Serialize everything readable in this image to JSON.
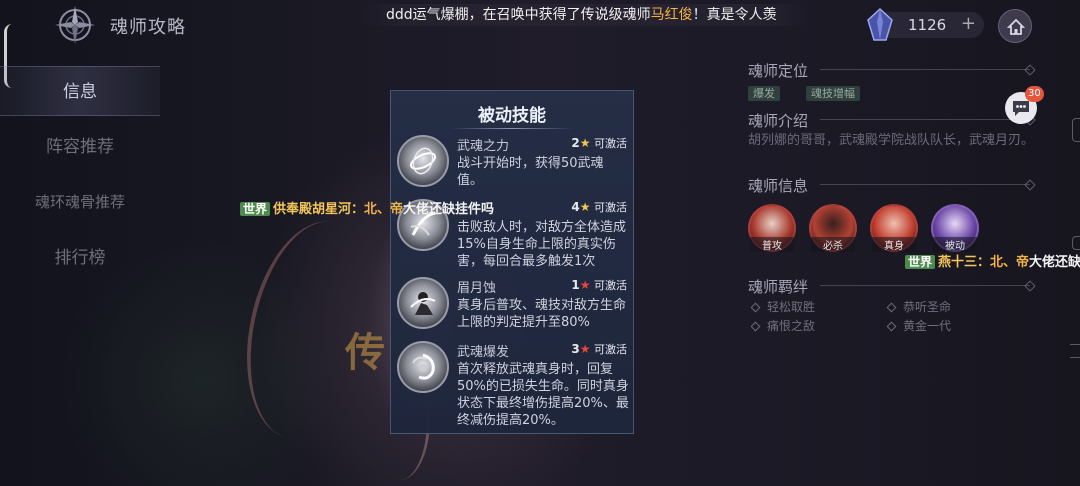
{
  "header": {
    "title": "魂师攻略",
    "marquee": {
      "prefix": "ddd运气爆棚，在召唤中获得了传说级魂师",
      "highlight": "马红俊",
      "suffix": "！真是令人羡"
    },
    "currency": {
      "value": "1126",
      "plus": "+"
    }
  },
  "nav": {
    "items": [
      {
        "label": "信息",
        "active": true
      },
      {
        "label": "阵容推荐"
      },
      {
        "label": "魂环魂骨推荐"
      },
      {
        "label": "排行榜"
      }
    ]
  },
  "world_chat": [
    {
      "tag": "世界",
      "name": "供奉殿胡星河：",
      "highlight": "北、帝",
      "text": "大佬还缺挂件吗"
    },
    {
      "tag": "世界",
      "name": "燕十三：",
      "highlight": "北、帝",
      "text": "大佬还缺"
    }
  ],
  "popup": {
    "title": "被动技能",
    "skills": [
      {
        "name": "武魂之力",
        "level": "2",
        "star": "★",
        "status": "可激活",
        "desc": "战斗开始时，获得50武魂值。"
      },
      {
        "name": "",
        "level": "4",
        "star": "★",
        "status": "可激活",
        "desc": "击败敌人时，对敌方全体造成15%自身生命上限的真实伤害，每回合最多触发1次"
      },
      {
        "name": "眉月蚀",
        "level": "1",
        "star": "★",
        "status": "可激活",
        "desc": "真身后普攻、魂技对敌方生命上限的判定提升至80%"
      },
      {
        "name": "武魂爆发",
        "level": "3",
        "star": "★",
        "status": "可激活",
        "desc": "首次释放武魂真身时，回复50%的已损失生命。同时真身状态下最终增伤提高20%、最终减伤提高20%。"
      }
    ]
  },
  "right_panel": {
    "position": {
      "heading": "魂师定位",
      "tags": [
        "爆发",
        "魂技增幅"
      ]
    },
    "intro": {
      "heading": "魂师介绍",
      "text": "胡列娜的哥哥，武魂殿学院战队队长，武魂月刃。"
    },
    "info": {
      "heading": "魂师信息",
      "skills": [
        "普攻",
        "必杀",
        "真身",
        "被动"
      ]
    },
    "bonds": {
      "heading": "魂师羁绊",
      "items": [
        "轻松取胜",
        "恭听圣命",
        "痛恨之敌",
        "黄金一代"
      ]
    }
  },
  "chat_button": {
    "badge": "30"
  },
  "colors": {
    "accent": "#f3b347",
    "badge": "#e5563c",
    "world_tag": "#4e8a4e"
  }
}
